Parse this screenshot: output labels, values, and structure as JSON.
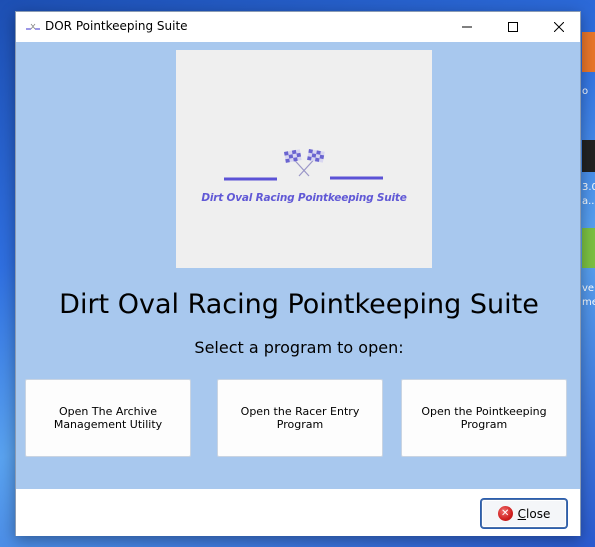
{
  "window": {
    "title": "DOR Pointkeeping Suite"
  },
  "logo": {
    "text": "Dirt Oval Racing Pointkeeping Suite",
    "accent_color": "#5b52d6"
  },
  "main": {
    "title": "Dirt Oval Racing Pointkeeping Suite",
    "subtitle": "Select a program to open:",
    "buttons": [
      {
        "label": "Open The Archive Management Utility"
      },
      {
        "label": "Open the Racer Entry Program"
      },
      {
        "label": "Open the Pointkeeping Program"
      }
    ]
  },
  "footer": {
    "close_label": "Close",
    "close_mnemonic": "C"
  },
  "desktop": {
    "fragments": [
      "o",
      "3.0",
      "a...",
      "ver",
      "me"
    ]
  },
  "colors": {
    "window_bg": "#a8c8ee",
    "footer_bg": "#ffffff",
    "button_bg": "#fdfdfd"
  }
}
